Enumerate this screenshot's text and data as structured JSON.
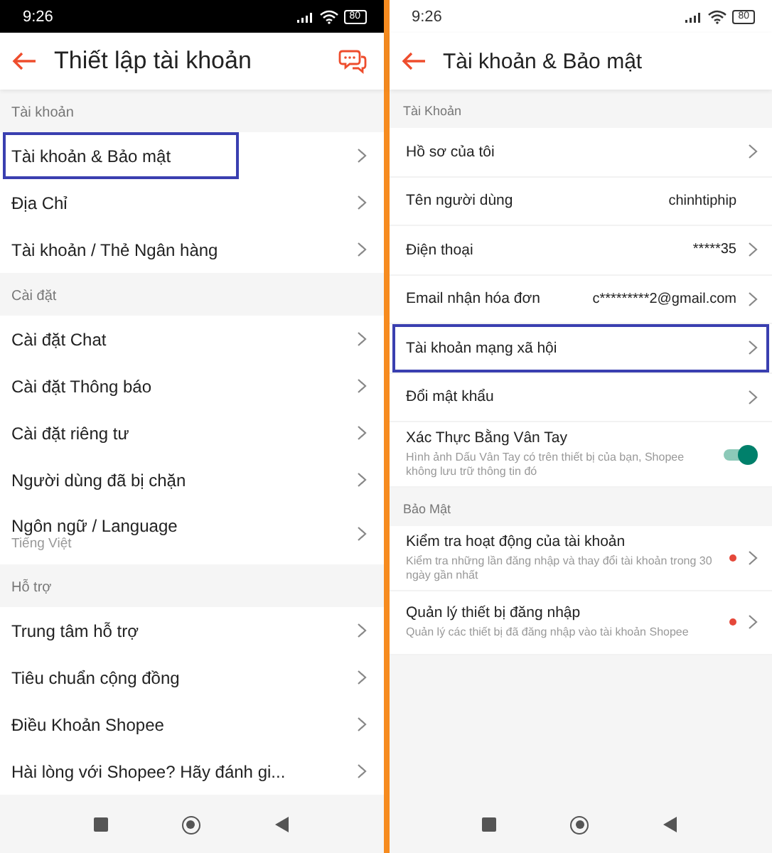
{
  "screens": [
    {
      "status_time": "9:26",
      "battery": "80",
      "dark_status": true,
      "title": "Thiết lập tài khoản",
      "chat_button": true,
      "highlight_wide": false,
      "sections": [
        {
          "label": "Tài khoản",
          "items": [
            {
              "label": "Tài khoản & Bảo mật",
              "selected": true
            },
            {
              "label": "Địa Chỉ",
              "selected": false
            },
            {
              "label": "Tài khoản / Thẻ Ngân hàng",
              "selected": false
            }
          ]
        },
        {
          "label": "Cài đặt",
          "items": [
            {
              "label": "Cài đặt Chat",
              "selected": false
            },
            {
              "label": "Cài đặt Thông báo",
              "selected": false
            },
            {
              "label": "Cài đặt riêng tư",
              "selected": false
            },
            {
              "label": "Người dùng đã bị chặn",
              "selected": false
            },
            {
              "label": "Ngôn ngữ / Language",
              "subtitle": "Tiếng Việt",
              "selected": false
            }
          ]
        },
        {
          "label": "Hỗ trợ",
          "items": [
            {
              "label": "Trung tâm hỗ trợ",
              "selected": false
            },
            {
              "label": "Tiêu chuẩn cộng đồng",
              "selected": false
            },
            {
              "label": "Điều Khoản Shopee",
              "selected": false
            },
            {
              "label": "Hài lòng với Shopee? Hãy đánh gi...",
              "selected": false
            }
          ]
        }
      ]
    },
    {
      "status_time": "9:26",
      "battery": "80",
      "dark_status": false,
      "title": "Tài khoản & Bảo mật",
      "chat_button": false,
      "highlight_wide": true,
      "sections": [
        {
          "label": "Tài Khoản",
          "items": [
            {
              "label": "Hồ sơ của tôi",
              "selected": false
            },
            {
              "label": "Tên người dùng",
              "value": "chinhtiphip",
              "arrow": false,
              "selected": false
            },
            {
              "label": "Điện thoại",
              "value": "*****35",
              "selected": false
            },
            {
              "label": "Email nhận hóa đơn",
              "value": "c*********2@gmail.com",
              "selected": false
            },
            {
              "label": "Tài khoản mạng xã hội",
              "selected": true
            },
            {
              "label": "Đổi mật khẩu",
              "selected": false
            },
            {
              "label": "Xác Thực Bằng Vân Tay",
              "subtitle": "Hình ảnh Dấu Vân Tay có trên thiết bị của bạn, Shopee không lưu trữ thông tin đó",
              "kind": "toggle",
              "on": true,
              "selected": false
            }
          ]
        },
        {
          "label": "Bảo Mật",
          "items": [
            {
              "label": "Kiểm tra hoạt động của tài khoản",
              "subtitle": "Kiểm tra những lần đăng nhập và thay đổi tài khoản trong 30 ngày gần nhất",
              "dot": true,
              "selected": false
            },
            {
              "label": "Quản lý thiết bị đăng nhập",
              "subtitle": "Quản lý các thiết bị đã đăng nhập vào tài khoản Shopee",
              "dot": true,
              "selected": false
            }
          ]
        }
      ]
    }
  ]
}
